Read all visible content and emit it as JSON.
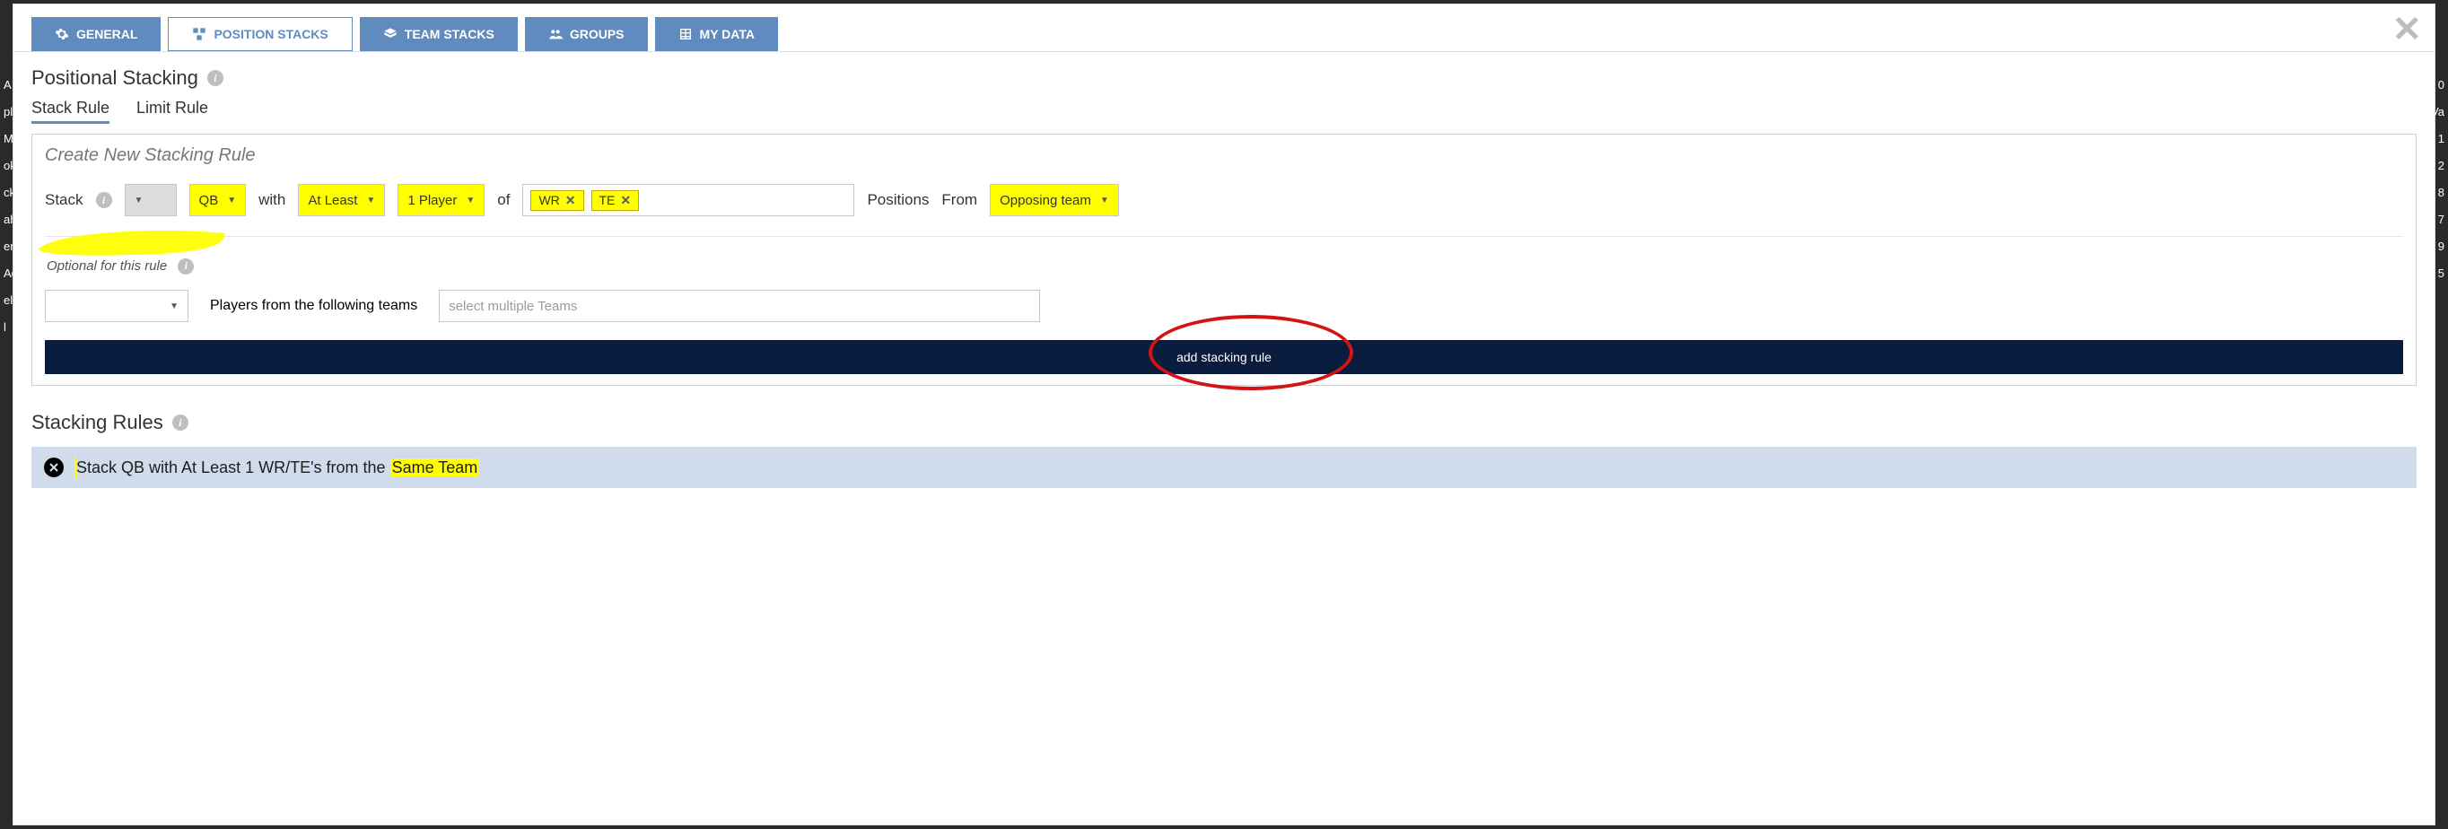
{
  "tabs": {
    "general": "GENERAL",
    "position_stacks": "POSITION STACKS",
    "team_stacks": "TEAM STACKS",
    "groups": "GROUPS",
    "my_data": "MY DATA"
  },
  "section": {
    "title": "Positional Stacking"
  },
  "sub_tabs": {
    "stack_rule": "Stack Rule",
    "limit_rule": "Limit Rule"
  },
  "panel": {
    "title": "Create New Stacking Rule",
    "stack_label": "Stack",
    "qb": "QB",
    "with": "with",
    "at_least": "At Least",
    "one_player": "1 Player",
    "of": "of",
    "pos_chips": [
      "WR",
      "TE"
    ],
    "positions": "Positions",
    "from": "From",
    "opposing_team": "Opposing team",
    "optional_label": "Optional for this rule",
    "players_from": "Players from the following teams",
    "team_placeholder": "select multiple Teams",
    "add_btn": "add stacking rule"
  },
  "rules": {
    "title": "Stacking Rules",
    "item_prefix": "Stack QB with At Least 1 WR/TE's from the ",
    "item_highlight": "Same Team"
  },
  "bg_left": [
    "A",
    "pla",
    "Ma",
    "ok",
    "cks",
    "ah",
    "en",
    "Ada",
    "el",
    "l",
    ""
  ],
  "bg_right": [
    "0",
    "Va",
    "1",
    "2",
    "8",
    "7",
    "9",
    "5"
  ]
}
